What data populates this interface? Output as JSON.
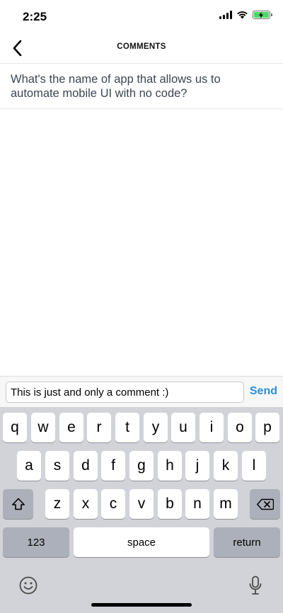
{
  "status_bar": {
    "time": "2:25",
    "battery_color": "#4cd964"
  },
  "nav": {
    "title": "COMMENTS",
    "back_icon": "chevron-left-icon"
  },
  "post": {
    "text": "What's the name of app that allows us to automate mobile UI with no code?"
  },
  "comment_bar": {
    "input_value": "This is just and only a comment :)",
    "send_label": "Send",
    "send_color": "#2a8fd9"
  },
  "keyboard": {
    "row1": [
      "q",
      "w",
      "e",
      "r",
      "t",
      "y",
      "u",
      "i",
      "o",
      "p"
    ],
    "row2": [
      "a",
      "s",
      "d",
      "f",
      "g",
      "h",
      "j",
      "k",
      "l"
    ],
    "row3": [
      "z",
      "x",
      "c",
      "v",
      "b",
      "n",
      "m"
    ],
    "numbers_label": "123",
    "space_label": "space",
    "return_label": "return"
  }
}
